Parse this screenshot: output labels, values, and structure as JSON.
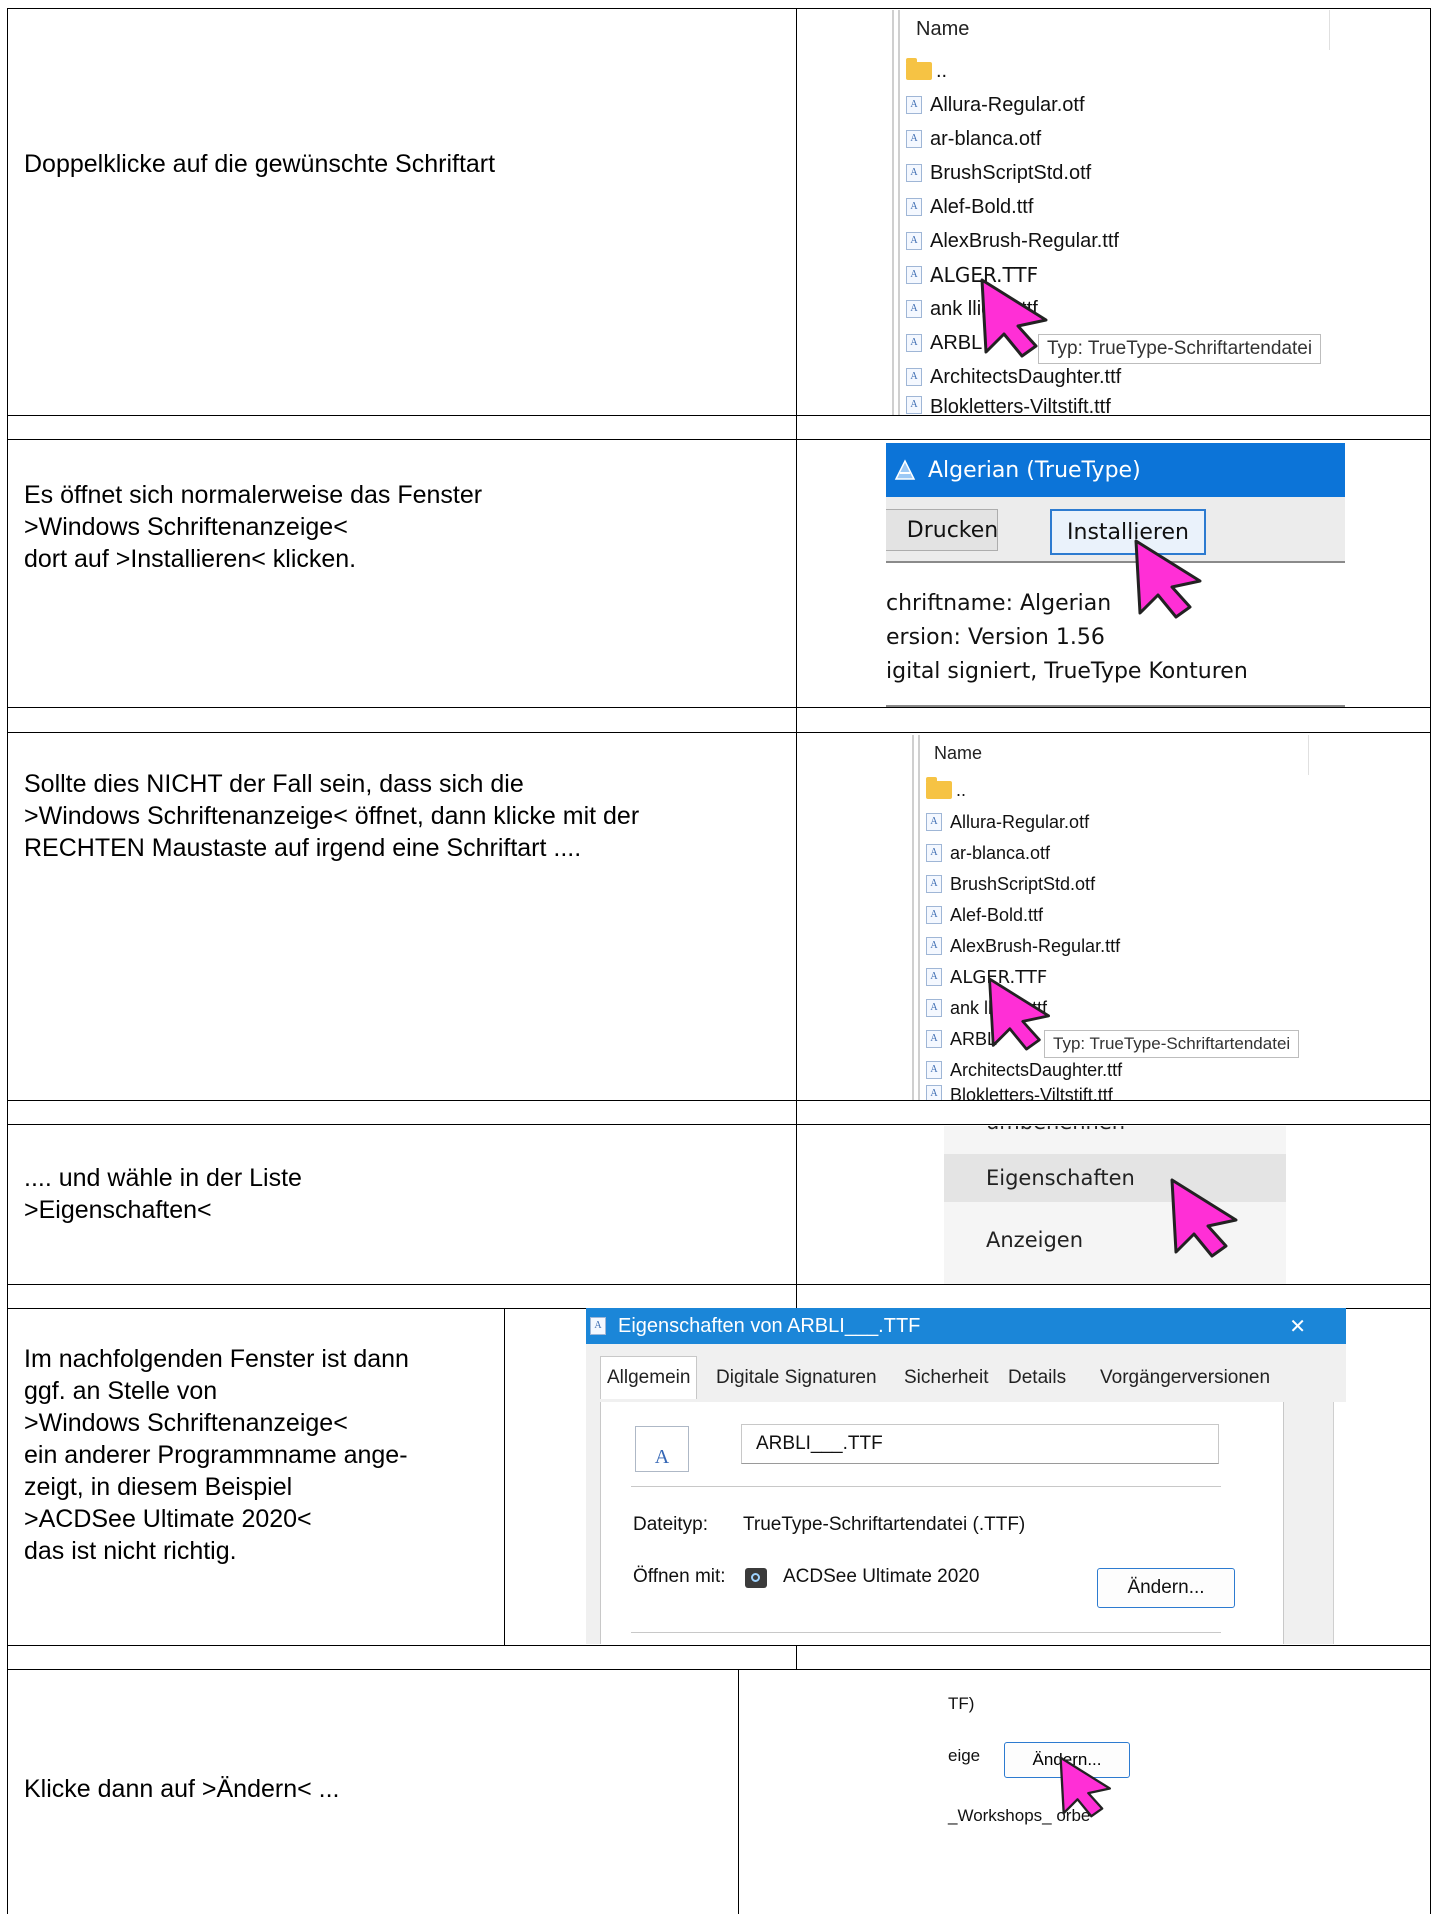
{
  "rows": [
    {
      "instruction": "Doppelklicke auf die gewünschte Schriftart"
    },
    {
      "instruction": "Es öffnet sich normalerweise das Fenster\n>Windows Schriftenanzeige<\ndort auf >Installieren< klicken."
    },
    {
      "instruction": "Sollte dies NICHT der Fall sein, dass sich die\n>Windows Schriftenanzeige< öffnet, dann klicke mit der\nRECHTEN Maustaste auf irgend eine Schriftart ...."
    },
    {
      "instruction": ".... und wähle in der Liste\n>Eigenschaften<"
    },
    {
      "instruction": "Im nachfolgenden Fenster ist dann\nggf. an Stelle von\n>Windows Schriftenanzeige<\nein anderer Programmname ange-\nzeigt, in diesem Beispiel\n>ACDSee Ultimate 2020<\ndas ist nicht richtig."
    },
    {
      "instruction": "Klicke dann auf >Ändern< ..."
    }
  ],
  "explorer": {
    "column_header": "Name",
    "parent_folder": "..",
    "files": [
      "Allura-Regular.otf",
      "ar-blanca.otf",
      "BrushScriptStd.otf",
      "Alef-Bold.ttf",
      "AlexBrush-Regular.ttf",
      "ALGER.TTF",
      "ank  llig-fg.ttf",
      "ARBL",
      "ArchitectsDaughter.ttf",
      "Blokletters-Viltstift.ttf"
    ],
    "tooltip": "Typ: TrueType-Schriftartendatei",
    "file_icon_glyph": "A"
  },
  "font_viewer": {
    "title": "Algerian (TrueType)",
    "print_button": "Drucken",
    "install_button": "Installieren",
    "info_lines": [
      "chriftname: Algerian",
      "ersion: Version 1.56",
      "igital signiert, TrueType Konturen"
    ]
  },
  "context_menu": {
    "items": [
      "umbenennen",
      "Eigenschaften",
      "Anzeigen"
    ]
  },
  "properties_dialog": {
    "title": "Eigenschaften von ARBLI___.TTF",
    "close_glyph": "✕",
    "tabs": [
      "Allgemein",
      "Digitale Signaturen",
      "Sicherheit",
      "Details",
      "Vorgängerversionen"
    ],
    "file_name": "ARBLI___.TTF",
    "file_type_label": "Dateityp:",
    "file_type_value": "TrueType-Schriftartendatei (.TTF)",
    "open_with_label": "Öffnen mit:",
    "open_with_value": "ACDSee Ultimate 2020",
    "change_button": "Ändern..."
  },
  "change_crop": {
    "line1": "TF)",
    "label": "eige",
    "button": "Ändern...",
    "line3": "_Workshops_   orbe"
  },
  "colors": {
    "cursor_fill": "#ff2fd6",
    "titlebar_blue": "#0c74d8",
    "button_border_blue": "#2d7bd0"
  }
}
